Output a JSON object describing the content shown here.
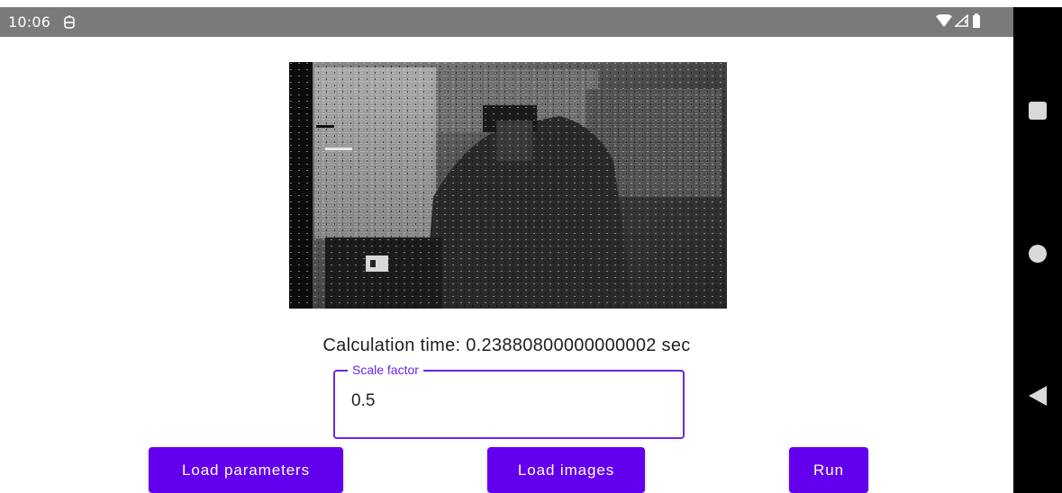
{
  "status_bar": {
    "time": "10:06",
    "background": "#7a7a7a",
    "icons": [
      "notification-icon",
      "wifi-icon",
      "signal-icon",
      "battery-icon"
    ]
  },
  "nav_bar": {
    "icons": [
      "recents-square-icon",
      "home-circle-icon",
      "back-triangle-icon"
    ]
  },
  "result": {
    "calculation_text": "Calculation time: 0.23880800000000002 sec"
  },
  "scale_field": {
    "label": "Scale factor",
    "value": "0.5"
  },
  "buttons": {
    "load_parameters": "Load parameters",
    "load_images": "Load images",
    "run": "Run"
  },
  "colors": {
    "accent": "#6200ee",
    "field_border": "#6a26e8"
  }
}
